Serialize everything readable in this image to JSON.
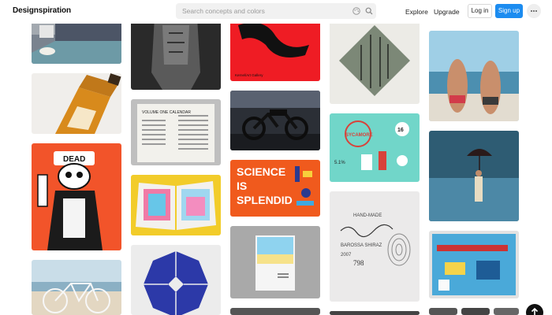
{
  "header": {
    "logo": "Designspiration",
    "search_placeholder": "Search concepts and colors",
    "nav": {
      "explore": "Explore",
      "upgrade": "Upgrade"
    },
    "login": "Log in",
    "signup": "Sign up",
    "accent_color": "#1c8cf0"
  },
  "tiles": {
    "gallery_caption": "Kernel/Art Gallery",
    "calendar_title": "VOLUME ONE CALENDAR",
    "science_line1": "SCIENCE",
    "science_line2": "IS",
    "science_line3": "SPLENDID",
    "label_hand_made": "HAND-MADE",
    "label_barossa": "BAROSSA SHIRAZ",
    "label_year": "2007",
    "label_number": "798",
    "sycamore_text": "SYCAMORE",
    "sycamore_num": "16",
    "sycamore_pct": "5.1%",
    "dead_text": "DEAD"
  },
  "icons": [
    "palette-icon",
    "search-icon",
    "more-icon",
    "arrow-up-icon"
  ]
}
